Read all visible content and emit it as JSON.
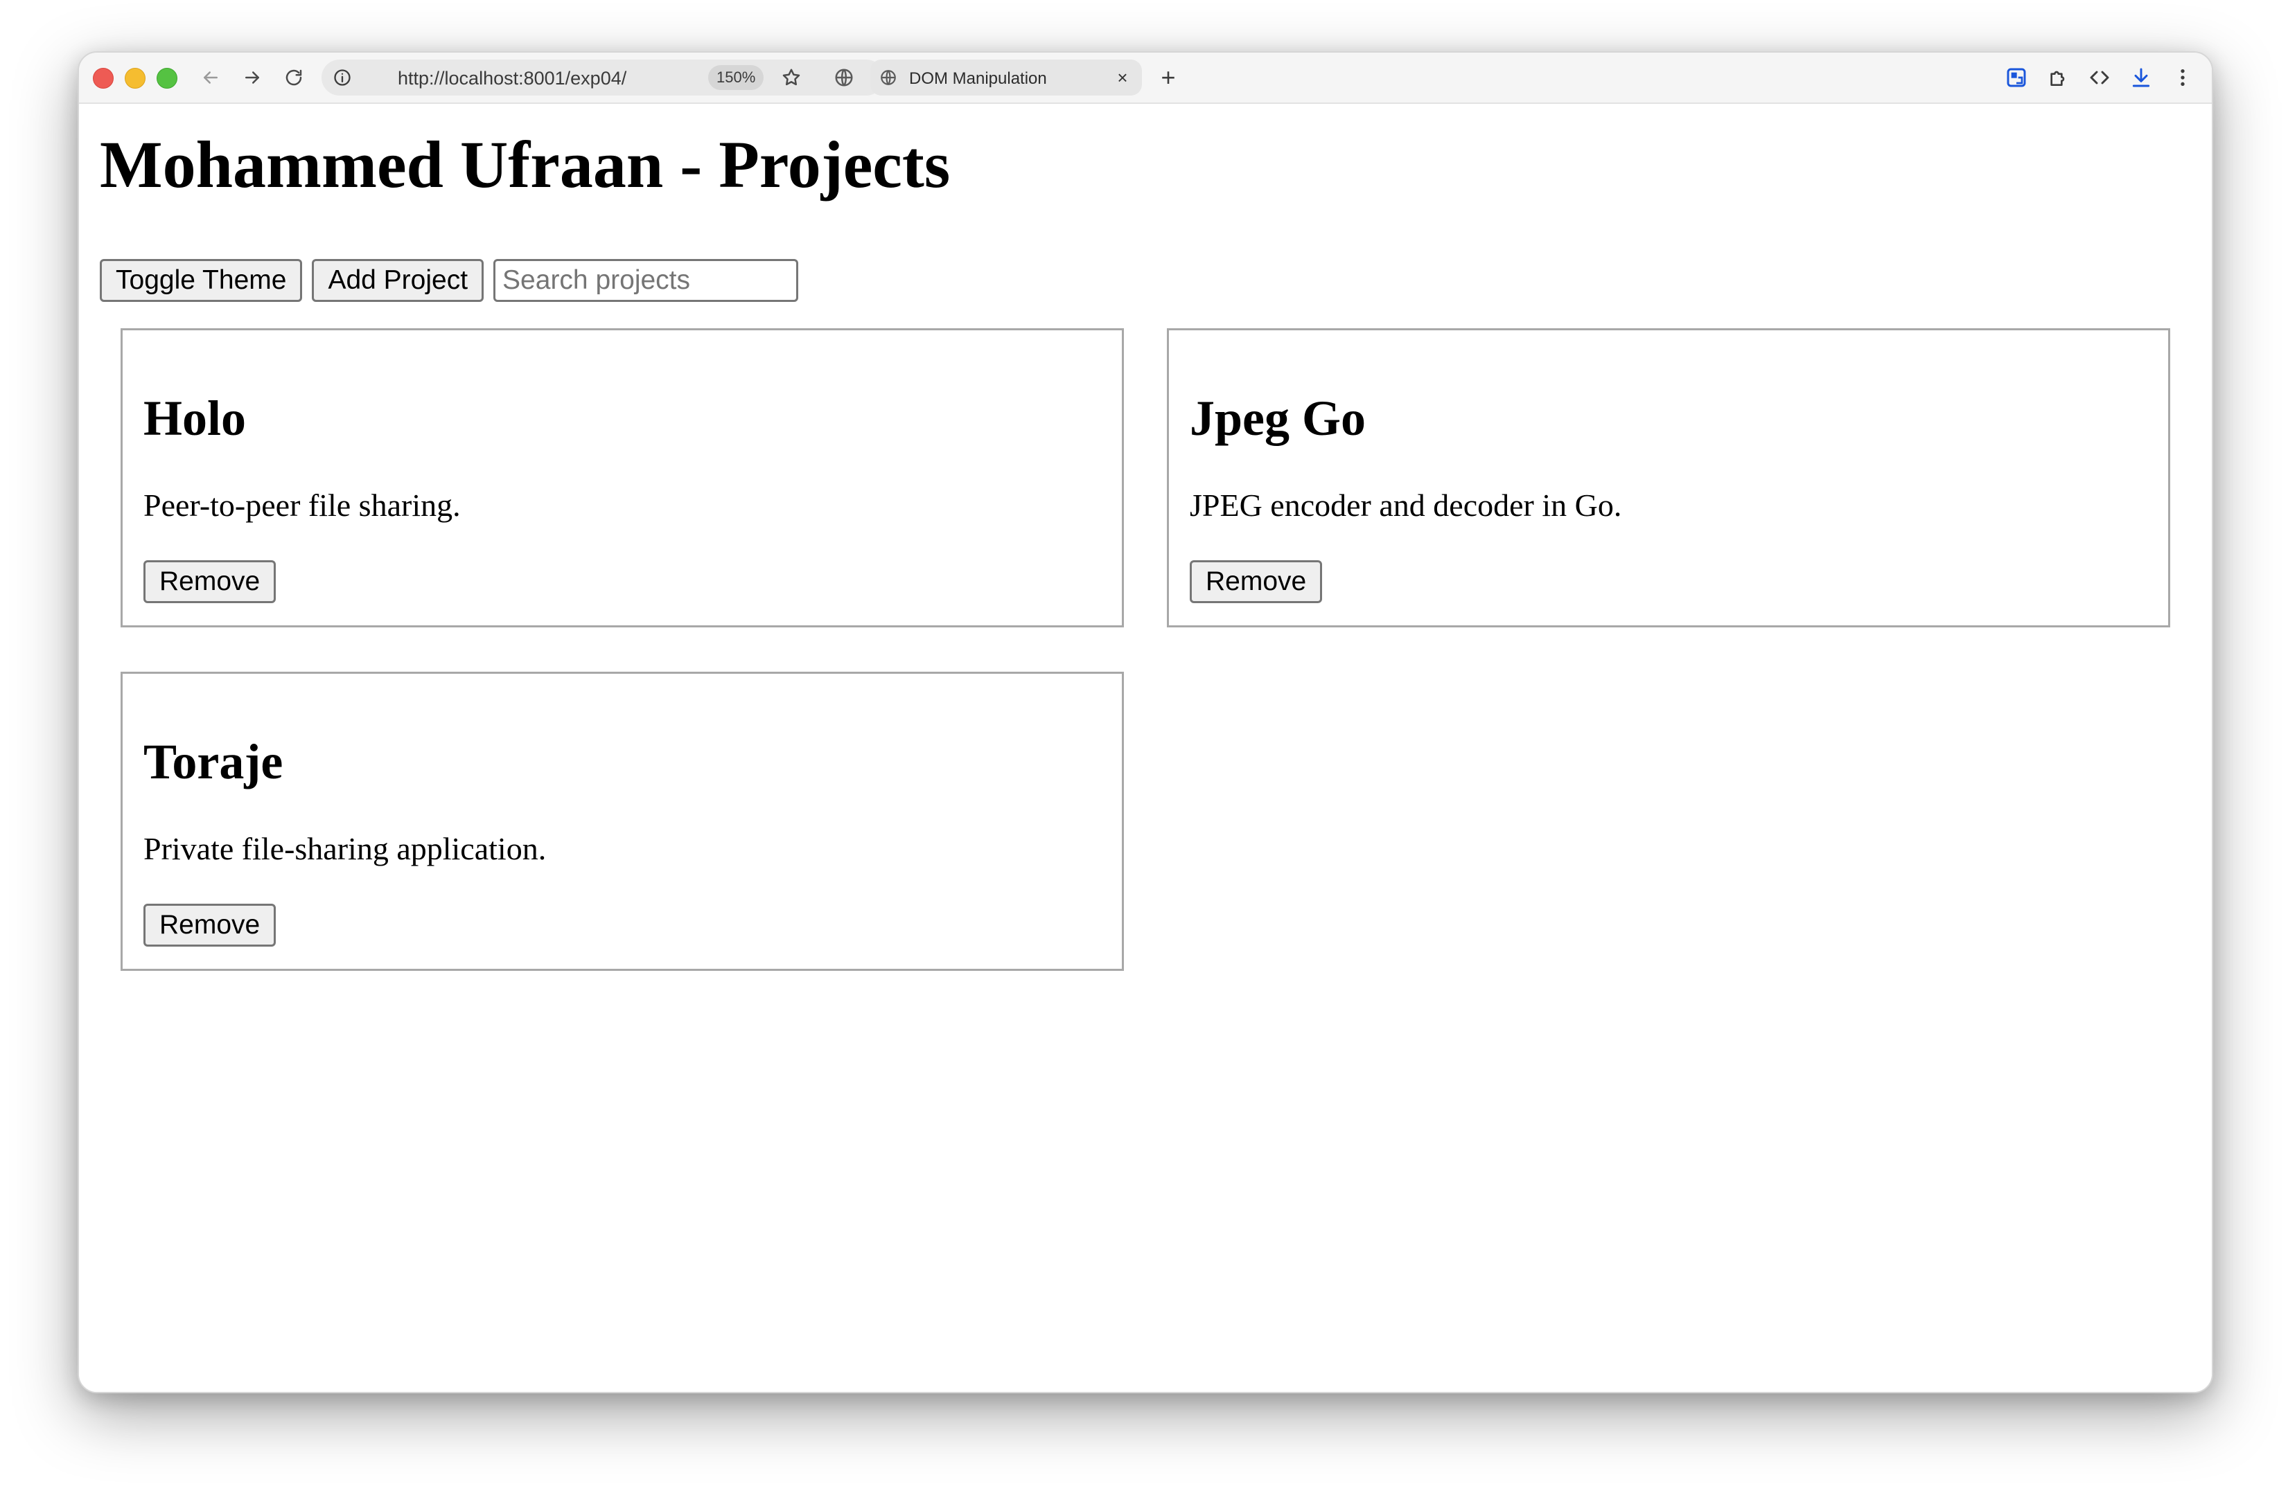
{
  "browser": {
    "url": "http://localhost:8001/exp04/",
    "zoom": "150%",
    "tab_title": "DOM Manipulation",
    "new_tab": "+",
    "tab_close": "×"
  },
  "page": {
    "title": "Mohammed Ufraan - Projects",
    "toggle_theme_label": "Toggle Theme",
    "add_project_label": "Add Project",
    "search_placeholder": "Search projects",
    "search_value": ""
  },
  "projects": [
    {
      "title": "Holo",
      "description": "Peer-to-peer file sharing.",
      "remove_label": "Remove"
    },
    {
      "title": "Jpeg Go",
      "description": "JPEG encoder and decoder in Go.",
      "remove_label": "Remove"
    },
    {
      "title": "Toraje",
      "description": "Private file-sharing application.",
      "remove_label": "Remove"
    }
  ],
  "icons": {
    "back": "arrow-left-icon",
    "forward": "arrow-right-icon",
    "reload": "reload-icon",
    "site_info": "info-circle-icon",
    "bookmark": "star-icon",
    "globe": "globe-icon",
    "tab_favicon": "globe-icon",
    "extension_blue": "extension-badge-icon",
    "extensions": "puzzle-icon",
    "devtools": "code-brackets-icon",
    "downloads": "download-icon",
    "menu": "kebab-menu-icon"
  },
  "colors": {
    "traffic_red": "#ee5b54",
    "traffic_yellow": "#f5bd30",
    "traffic_green": "#55c242",
    "accent_blue": "#1a56db",
    "card_border": "#a8a8a8"
  }
}
